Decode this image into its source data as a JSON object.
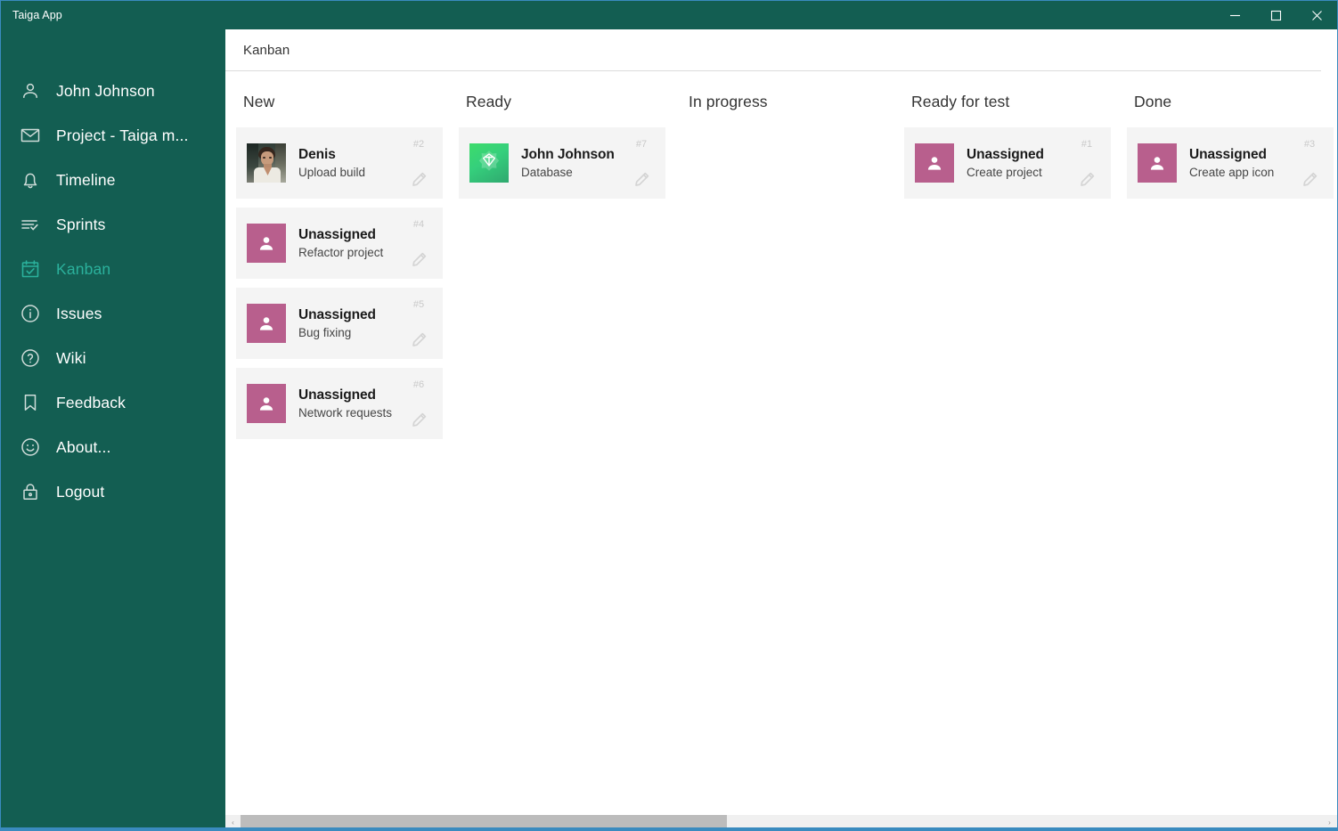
{
  "window": {
    "title": "Taiga App",
    "controls": [
      {
        "name": "minimize",
        "label": "—"
      },
      {
        "name": "maximize",
        "label": "□"
      },
      {
        "name": "close",
        "label": "✕"
      }
    ]
  },
  "sidebar": {
    "items": [
      {
        "label": "John Johnson",
        "icon": "user-icon",
        "active": false
      },
      {
        "label": "Project - Taiga m...",
        "icon": "mail-icon",
        "active": false
      },
      {
        "label": "Timeline",
        "icon": "bell-icon",
        "active": false
      },
      {
        "label": "Sprints",
        "icon": "list-check-icon",
        "active": false
      },
      {
        "label": "Kanban",
        "icon": "calendar-check-icon",
        "active": true
      },
      {
        "label": "Issues",
        "icon": "info-circle-icon",
        "active": false
      },
      {
        "label": "Wiki",
        "icon": "question-circle-icon",
        "active": false
      },
      {
        "label": "Feedback",
        "icon": "bookmark-icon",
        "active": false
      },
      {
        "label": "About...",
        "icon": "smiley-icon",
        "active": false
      },
      {
        "label": "Logout",
        "icon": "lock-icon",
        "active": false
      }
    ]
  },
  "page": {
    "title": "Kanban"
  },
  "board": {
    "columns": [
      {
        "title": "New",
        "cards": [
          {
            "assignee": "Denis",
            "subject": "Upload build",
            "ref": "#2",
            "avatar": "photo"
          },
          {
            "assignee": "Unassigned",
            "subject": "Refactor project",
            "ref": "#4",
            "avatar": "unassigned"
          },
          {
            "assignee": "Unassigned",
            "subject": "Bug fixing",
            "ref": "#5",
            "avatar": "unassigned"
          },
          {
            "assignee": "Unassigned",
            "subject": "Network requests",
            "ref": "#6",
            "avatar": "unassigned"
          }
        ]
      },
      {
        "title": "Ready",
        "cards": [
          {
            "assignee": "John Johnson",
            "subject": "Database",
            "ref": "#7",
            "avatar": "taiga"
          }
        ]
      },
      {
        "title": "In progress",
        "cards": []
      },
      {
        "title": "Ready for test",
        "cards": [
          {
            "assignee": "Unassigned",
            "subject": "Create project",
            "ref": "#1",
            "avatar": "unassigned"
          }
        ]
      },
      {
        "title": "Done",
        "cards": [
          {
            "assignee": "Unassigned",
            "subject": "Create app icon",
            "ref": "#3",
            "avatar": "unassigned"
          }
        ]
      }
    ]
  },
  "scrollbar": {
    "left_arrow": "‹",
    "right_arrow": "›",
    "thumb_percent": 45
  },
  "colors": {
    "sidebar_bg": "#135e52",
    "accent": "#2bb19c",
    "card_bg": "#f4f4f4",
    "avatar_unassigned": "#b85f8d",
    "window_border": "#3a8bbf"
  }
}
